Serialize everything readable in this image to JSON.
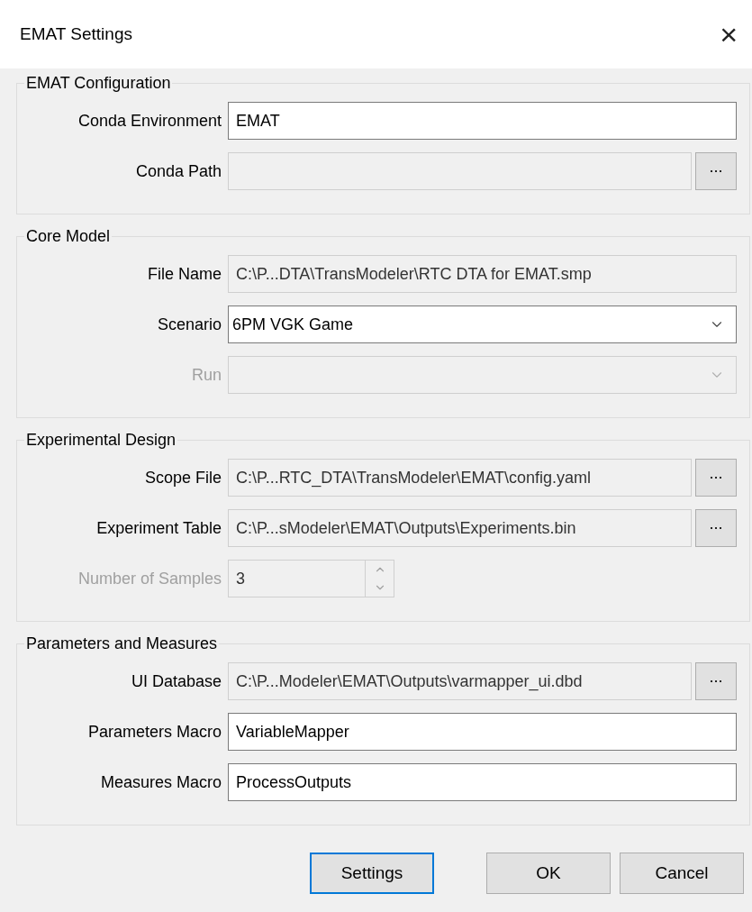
{
  "window": {
    "title": "EMAT Settings",
    "close": "×"
  },
  "sections": [
    {
      "title": "EMAT Configuration",
      "rows": [
        {
          "kind": "text",
          "label": "Conda Environment",
          "value": "EMAT",
          "editable": true,
          "disabled": false
        },
        {
          "kind": "browse",
          "label": "Conda Path",
          "editable": false,
          "disabled": false,
          "browse": "..."
        }
      ]
    },
    {
      "title": "Core Model",
      "rows": [
        {
          "kind": "text",
          "label": "File Name",
          "value": "C:\\P...DTA\\TransModeler\\RTC DTA for EMAT.smp",
          "editable": false,
          "disabled": false
        },
        {
          "kind": "dropdown",
          "label": "Scenario",
          "value": "6PM VGK Game",
          "editable": true,
          "disabled": false
        },
        {
          "kind": "dropdown",
          "label": "Run",
          "editable": false,
          "disabled": true
        }
      ]
    },
    {
      "title": "Experimental Design",
      "rows": [
        {
          "kind": "browse",
          "label": "Scope File",
          "value": "C:\\P...RTC_DTA\\TransModeler\\EMAT\\config.yaml",
          "editable": false,
          "disabled": false,
          "browse": "..."
        },
        {
          "kind": "browse",
          "label": "Experiment Table",
          "value": "C:\\P...sModeler\\EMAT\\Outputs\\Experiments.bin",
          "editable": false,
          "disabled": false,
          "browse": "..."
        },
        {
          "kind": "spinner",
          "label": "Number of Samples",
          "value": "3",
          "editable": false,
          "disabled": true
        }
      ]
    },
    {
      "title": "Parameters and Measures",
      "rows": [
        {
          "kind": "browse",
          "label": "UI Database",
          "value": "C:\\P...Modeler\\EMAT\\Outputs\\varmapper_ui.dbd",
          "editable": false,
          "disabled": false,
          "browse": "..."
        },
        {
          "kind": "text",
          "label": "Parameters Macro",
          "value": "VariableMapper",
          "editable": true,
          "disabled": false
        },
        {
          "kind": "text",
          "label": "Measures Macro",
          "value": "ProcessOutputs",
          "editable": true,
          "disabled": false
        }
      ]
    }
  ],
  "buttons": [
    {
      "label": "Settings",
      "focused": true
    },
    {
      "label": "OK",
      "focused": false
    },
    {
      "label": "Cancel",
      "focused": false
    }
  ]
}
